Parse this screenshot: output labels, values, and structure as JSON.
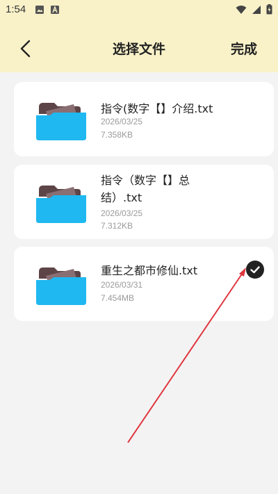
{
  "status_bar": {
    "time": "1:54",
    "icons_left": [
      "image-icon",
      "font-a-icon"
    ],
    "icons_right": [
      "wifi-icon",
      "signal-icon",
      "battery-charging-icon"
    ]
  },
  "header": {
    "title": "选择文件",
    "back_icon": "chevron-left-icon",
    "done_label": "完成",
    "background_color": "#f9f2c9"
  },
  "files": [
    {
      "name": "指令(数字【】介绍.txt",
      "date": "2026/03/25",
      "size": "7.358KB",
      "selected": false
    },
    {
      "name": "指令（数字【】总结）.txt",
      "date": "2026/03/25",
      "size": "7.312KB",
      "selected": false
    },
    {
      "name": "重生之都市修仙.txt",
      "date": "2026/03/31",
      "size": "7.454MB",
      "selected": true
    }
  ],
  "colors": {
    "folder_body": "#1fb8f0",
    "folder_back": "#5d4447",
    "annotation_arrow": "#e0343d"
  }
}
